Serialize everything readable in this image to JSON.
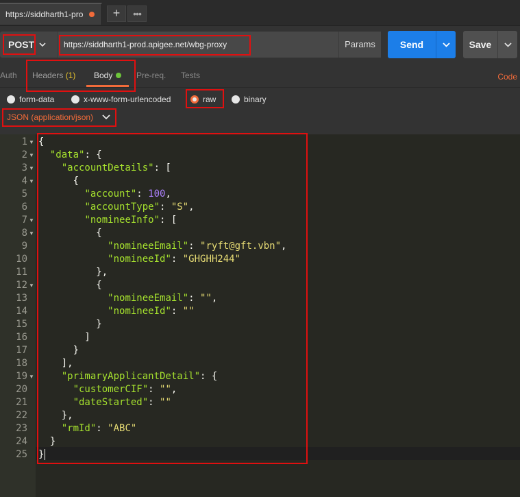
{
  "tab": {
    "title": "https://siddharth1-pro",
    "new_tab": "+",
    "more": "•••"
  },
  "request": {
    "method": "POST",
    "url": "https://siddharth1-prod.apigee.net/wbg-proxy",
    "params_label": "Params",
    "send_label": "Send",
    "save_label": "Save"
  },
  "subtabs": {
    "auth": "Auth",
    "headers": "Headers",
    "headers_count": "(1)",
    "body": "Body",
    "prereq": "Pre-req.",
    "tests": "Tests",
    "code": "Code"
  },
  "body_types": {
    "form_data": "form-data",
    "urlencoded": "x-www-form-urlencoded",
    "raw": "raw",
    "binary": "binary",
    "selected": "raw"
  },
  "content_type": "JSON (application/json)",
  "colors": {
    "accent": "#f26b3a",
    "send": "#1c7ee8",
    "highlight": "#e01010",
    "active_dot": "#6dc53a"
  },
  "editor": {
    "line_numbers": [
      "1",
      "2",
      "3",
      "4",
      "5",
      "6",
      "7",
      "8",
      "9",
      "10",
      "11",
      "12",
      "13",
      "14",
      "15",
      "16",
      "17",
      "18",
      "19",
      "20",
      "21",
      "22",
      "23",
      "24",
      "25"
    ],
    "lines": [
      [
        {
          "t": "{",
          "c": "p"
        }
      ],
      [
        {
          "t": "  ",
          "c": "p"
        },
        {
          "t": "\"data\"",
          "c": "k"
        },
        {
          "t": ": {",
          "c": "p"
        }
      ],
      [
        {
          "t": "    ",
          "c": "p"
        },
        {
          "t": "\"accountDetails\"",
          "c": "k"
        },
        {
          "t": ": [",
          "c": "p"
        }
      ],
      [
        {
          "t": "      {",
          "c": "p"
        }
      ],
      [
        {
          "t": "        ",
          "c": "p"
        },
        {
          "t": "\"account\"",
          "c": "k"
        },
        {
          "t": ": ",
          "c": "p"
        },
        {
          "t": "100",
          "c": "n"
        },
        {
          "t": ",",
          "c": "p"
        }
      ],
      [
        {
          "t": "        ",
          "c": "p"
        },
        {
          "t": "\"accountType\"",
          "c": "k"
        },
        {
          "t": ": ",
          "c": "p"
        },
        {
          "t": "\"S\"",
          "c": "s"
        },
        {
          "t": ",",
          "c": "p"
        }
      ],
      [
        {
          "t": "        ",
          "c": "p"
        },
        {
          "t": "\"nomineeInfo\"",
          "c": "k"
        },
        {
          "t": ": [",
          "c": "p"
        }
      ],
      [
        {
          "t": "          {",
          "c": "p"
        }
      ],
      [
        {
          "t": "            ",
          "c": "p"
        },
        {
          "t": "\"nomineeEmail\"",
          "c": "k"
        },
        {
          "t": ": ",
          "c": "p"
        },
        {
          "t": "\"ryft@gft.vbn\"",
          "c": "s"
        },
        {
          "t": ",",
          "c": "p"
        }
      ],
      [
        {
          "t": "            ",
          "c": "p"
        },
        {
          "t": "\"nomineeId\"",
          "c": "k"
        },
        {
          "t": ": ",
          "c": "p"
        },
        {
          "t": "\"GHGHH244\"",
          "c": "s"
        }
      ],
      [
        {
          "t": "          },",
          "c": "p"
        }
      ],
      [
        {
          "t": "          {",
          "c": "p"
        }
      ],
      [
        {
          "t": "            ",
          "c": "p"
        },
        {
          "t": "\"nomineeEmail\"",
          "c": "k"
        },
        {
          "t": ": ",
          "c": "p"
        },
        {
          "t": "\"\"",
          "c": "s"
        },
        {
          "t": ",",
          "c": "p"
        }
      ],
      [
        {
          "t": "            ",
          "c": "p"
        },
        {
          "t": "\"nomineeId\"",
          "c": "k"
        },
        {
          "t": ": ",
          "c": "p"
        },
        {
          "t": "\"\"",
          "c": "s"
        }
      ],
      [
        {
          "t": "          }",
          "c": "p"
        }
      ],
      [
        {
          "t": "        ]",
          "c": "p"
        }
      ],
      [
        {
          "t": "      }",
          "c": "p"
        }
      ],
      [
        {
          "t": "    ],",
          "c": "p"
        }
      ],
      [
        {
          "t": "    ",
          "c": "p"
        },
        {
          "t": "\"primaryApplicantDetail\"",
          "c": "k"
        },
        {
          "t": ": {",
          "c": "p"
        }
      ],
      [
        {
          "t": "      ",
          "c": "p"
        },
        {
          "t": "\"customerCIF\"",
          "c": "k"
        },
        {
          "t": ": ",
          "c": "p"
        },
        {
          "t": "\"\"",
          "c": "s"
        },
        {
          "t": ",",
          "c": "p"
        }
      ],
      [
        {
          "t": "      ",
          "c": "p"
        },
        {
          "t": "\"dateStarted\"",
          "c": "k"
        },
        {
          "t": ": ",
          "c": "p"
        },
        {
          "t": "\"\"",
          "c": "s"
        }
      ],
      [
        {
          "t": "    },",
          "c": "p"
        }
      ],
      [
        {
          "t": "    ",
          "c": "p"
        },
        {
          "t": "\"rmId\"",
          "c": "k"
        },
        {
          "t": ": ",
          "c": "p"
        },
        {
          "t": "\"ABC\"",
          "c": "s"
        }
      ],
      [
        {
          "t": "  }",
          "c": "p"
        }
      ],
      [
        {
          "t": "}",
          "c": "p"
        }
      ]
    ],
    "foldable_lines": [
      "1",
      "2",
      "3",
      "4",
      "7",
      "8",
      "12",
      "19"
    ]
  }
}
